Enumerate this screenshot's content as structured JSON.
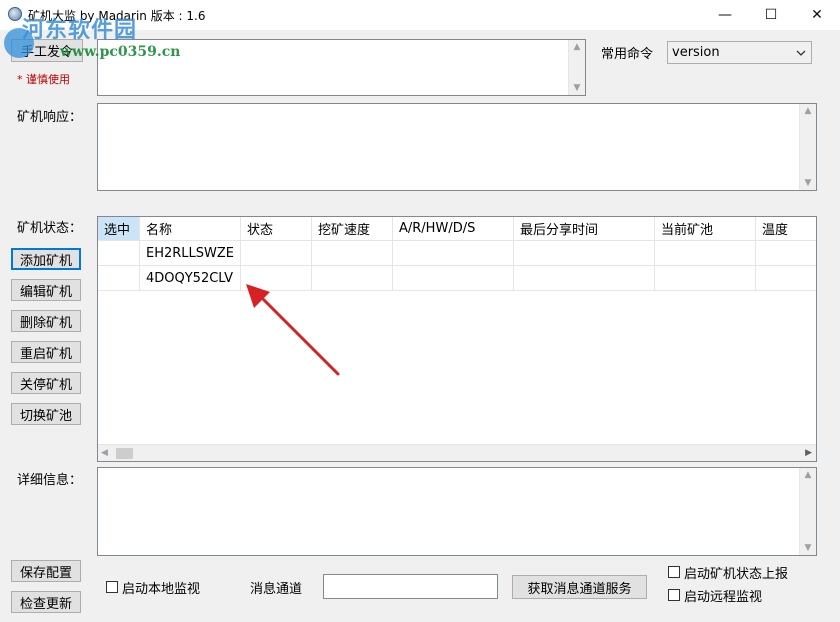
{
  "window": {
    "title": "矿机大监 by Madarin 版本 : 1.6",
    "minimize_glyph": "—",
    "maximize_glyph": "☐",
    "close_glyph": "✕"
  },
  "watermark": {
    "text": "河东软件园",
    "url": "www.pc0359.cn"
  },
  "command": {
    "manual_button": "手工发令",
    "warning": "* 谨慎使用",
    "input_value": "",
    "common_label": "常用命令",
    "common_selected": "version"
  },
  "response": {
    "label": "矿机响应：",
    "value": ""
  },
  "status": {
    "label": "矿机状态：",
    "columns": [
      "选中",
      "名称",
      "状态",
      "挖矿速度",
      "A/R/HW/D/S",
      "最后分享时间",
      "当前矿池",
      "温度"
    ],
    "rows": [
      {
        "selected": "",
        "name": "EH2RLLSWZE",
        "state": "",
        "speed": "",
        "ar": "",
        "last_share": "",
        "pool": "",
        "temp": ""
      },
      {
        "selected": "",
        "name": "4DOQY52CLV",
        "state": "",
        "speed": "",
        "ar": "",
        "last_share": "",
        "pool": "",
        "temp": ""
      }
    ]
  },
  "actions": {
    "add": "添加矿机",
    "edit": "编辑矿机",
    "delete": "删除矿机",
    "restart": "重启矿机",
    "stop": "关停矿机",
    "switch_pool": "切换矿池"
  },
  "details": {
    "label": "详细信息：",
    "value": ""
  },
  "footer": {
    "save_config": "保存配置",
    "check_update": "检查更新",
    "local_monitor": "启动本地监视",
    "channel_label": "消息通道",
    "channel_value": "",
    "get_channel": "获取消息通道服务",
    "report_status": "启动矿机状态上报",
    "remote_monitor": "启动远程监视"
  },
  "colors": {
    "accent": "#0078d7",
    "arrow": "#d62222",
    "header_selected": "#cce4f7"
  }
}
